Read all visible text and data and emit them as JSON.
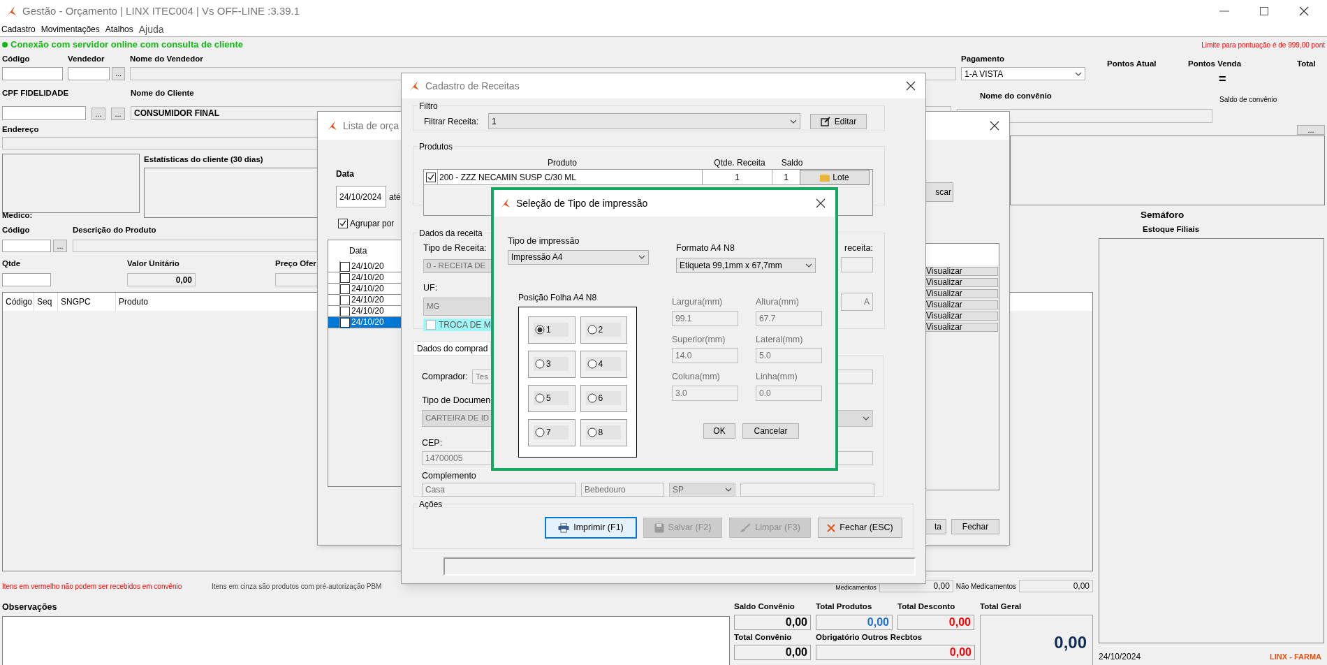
{
  "window": {
    "title": "Gestão - Orçamento  | LINX ITEC004 | Vs OFF-LINE :3.39.1"
  },
  "menu": [
    {
      "label": "Cadastro"
    },
    {
      "label": "Movimentações"
    },
    {
      "label": "Atalhos"
    },
    {
      "label": "Ajuda"
    }
  ],
  "connection": "Conexão com servidor online com consulta de cliente",
  "limit_note": "Limite para pontuação é de 999,00 pont",
  "seller": {
    "code_label": "Código",
    "seller_label": "Vendedor",
    "browse": "...",
    "name_label": "Nome do Vendedor"
  },
  "payment": {
    "label": "Pagamento",
    "value": "1-A VISTA"
  },
  "points": {
    "current_label": "Pontos Atual",
    "sale_label": "Pontos Venda",
    "total_label": "Total",
    "equals": "="
  },
  "client": {
    "cpf_label": "CPF FIDELIDADE",
    "browse_1": "...",
    "browse_2": "...",
    "name_label": "Nome do Cliente",
    "name_value": "CONSUMIDOR FINAL"
  },
  "agreement": {
    "name_label": "Nome do convênio",
    "balance_label": "Saldo de convênio",
    "browse": "..."
  },
  "address_label": "Endereço",
  "stats_label": "Estatísticas do cliente  (30 dias)",
  "doctor_label": "Medico:",
  "product": {
    "code_label": "Código",
    "browse": "...",
    "description_label": "Descrição do Produto",
    "qty_label": "Qtde",
    "unit_price_label": "Valor Unitário",
    "unit_price_value": "0,00",
    "offer_price_label": "Preço Ofer"
  },
  "items_table": {
    "columns": [
      "Código",
      "Seq",
      "SNGPC",
      "Produto"
    ]
  },
  "notes": {
    "red": "Itens em vermelho não podem ser recebidos em convênio",
    "gray": "Itens em cinza são produtos com pré-autorização PBM"
  },
  "subtotals": {
    "medicines_label": "Medicamentos",
    "medicines_value": "0,00",
    "non_medicines_label": "Não Medicamentos",
    "non_medicines_value": "0,00"
  },
  "observations_label": "Observações",
  "totals": [
    {
      "label": "Saldo Convênio",
      "value": "0,00",
      "color": "#000000"
    },
    {
      "label": "Total Produtos",
      "value": "0,00",
      "color": "#1a6fd0"
    },
    {
      "label": "Total Desconto",
      "value": "0,00",
      "color": "#ff0000"
    },
    {
      "label": "Total Convênio",
      "value": "0,00",
      "color": "#000000"
    },
    {
      "label": "Obrigatório Outros Recbtos",
      "value": "0,00",
      "color": "#ff0000"
    }
  ],
  "grand_total": {
    "label": "Total Geral",
    "value": "0,00"
  },
  "semaphore": {
    "title": "Semáforo",
    "subtitle": "Estoque Filiais"
  },
  "footer": {
    "date": "24/10/2024",
    "brand": "LINX - FARMA"
  },
  "quotes_dialog": {
    "title": "Lista de orça",
    "date_label": "Data",
    "date_from": "24/10/2024",
    "until": "até",
    "group_by": {
      "label": "Agrupar por",
      "checked": true
    },
    "search_button": "scar",
    "date_column": "Data",
    "rows": [
      {
        "date": "24/10/20",
        "checked": false,
        "action": "Visualizar",
        "selected": false
      },
      {
        "date": "24/10/20",
        "checked": false,
        "action": "Visualizar",
        "selected": false
      },
      {
        "date": "24/10/20",
        "checked": false,
        "action": "Visualizar",
        "selected": false
      },
      {
        "date": "24/10/20",
        "checked": false,
        "action": "Visualizar",
        "selected": false
      },
      {
        "date": "24/10/20",
        "checked": false,
        "action": "Visualizar",
        "selected": false
      },
      {
        "date": "24/10/20",
        "checked": false,
        "action": "Visualizar",
        "selected": true
      }
    ],
    "buttons": [
      "ta",
      "Fechar"
    ]
  },
  "recipe_dialog": {
    "title": "Cadastro de Receitas",
    "filter": {
      "group": "Filtro",
      "label": "Filtrar Receita:",
      "value": "1",
      "edit_button": "Editar"
    },
    "products": {
      "group": "Produtos",
      "columns": [
        "Produto",
        "Qtde. Receita",
        "Saldo"
      ],
      "rows": [
        {
          "checked": true,
          "product": "200 - ZZZ NECAMIN SUSP C/30 ML",
          "qty": "1",
          "balance": "1",
          "batch_button": "Lote"
        }
      ]
    },
    "recipe_data": {
      "group": "Dados da receita",
      "type_label": "Tipo de Receita:",
      "type_value": "0 - RECEITA DE",
      "uf_label": "UF:",
      "uf_value": "MG",
      "right_label": "receita:",
      "right_value": "A",
      "swap": {
        "label": "TROCA DE M",
        "checked": false
      }
    },
    "buyer_tab": "Dados do comprad",
    "buyer": {
      "buyer_label": "Comprador:",
      "buyer_value": "Tes",
      "doc_type_label": "Tipo de Documen",
      "doc_type_value": "CARTEIRA DE ID",
      "cep_label": "CEP:",
      "cep_value": "14700005",
      "complement_label": "Complemento",
      "complement_value": "Casa",
      "city_value": "Bebedouro",
      "uf_value": "SP"
    },
    "actions": {
      "group": "Ações",
      "buttons": [
        {
          "label": "Imprimir (F1)",
          "kind": "print",
          "disabled": false,
          "focused": true
        },
        {
          "label": "Salvar (F2)",
          "kind": "save",
          "disabled": true,
          "focused": false
        },
        {
          "label": "Limpar (F3)",
          "kind": "clear",
          "disabled": true,
          "focused": false
        },
        {
          "label": "Fechar (ESC)",
          "kind": "close",
          "disabled": false,
          "focused": false
        }
      ]
    }
  },
  "print_dialog": {
    "title": "Seleção de Tipo de impressão",
    "type_label": "Tipo de impressão",
    "type_value": "Impressão A4",
    "format_label": "Formato A4 N8",
    "format_value": "Etiqueta 99,1mm x 67,7mm",
    "position_label": "Posição Folha A4 N8",
    "positions": [
      {
        "label": "1",
        "selected": true
      },
      {
        "label": "2",
        "selected": false
      },
      {
        "label": "3",
        "selected": false
      },
      {
        "label": "4",
        "selected": false
      },
      {
        "label": "5",
        "selected": false
      },
      {
        "label": "6",
        "selected": false
      },
      {
        "label": "7",
        "selected": false
      },
      {
        "label": "8",
        "selected": false
      }
    ],
    "measures": [
      {
        "label": "Largura(mm)",
        "value": "99.1"
      },
      {
        "label": "Altura(mm)",
        "value": "67.7"
      },
      {
        "label": "Superior(mm)",
        "value": "14.0"
      },
      {
        "label": "Lateral(mm)",
        "value": "5.0"
      },
      {
        "label": "Coluna(mm)",
        "value": "3.0"
      },
      {
        "label": "Linha(mm)",
        "value": "0.0"
      }
    ],
    "ok": "OK",
    "cancel": "Cancelar"
  }
}
